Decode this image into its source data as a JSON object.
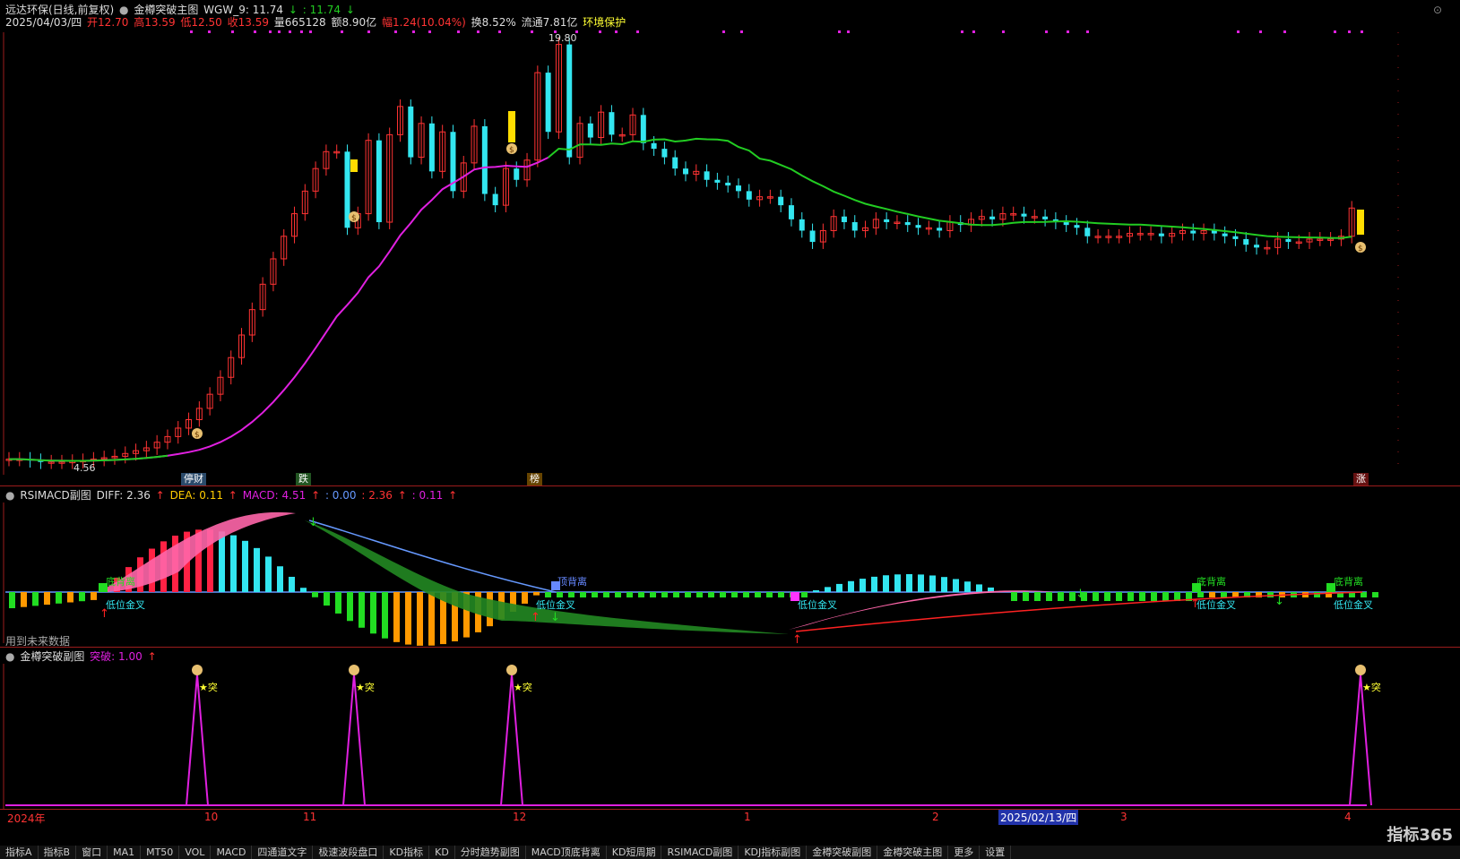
{
  "main": {
    "title": "远达环保(日线,前复权)",
    "indicator_name": "金樽突破主图",
    "wgw_label": "WGW_9: 11.74",
    "wgw_value2": ": 11.74",
    "date": "2025/04/03/四",
    "open": "开12.70",
    "high": "高13.59",
    "low": "低12.50",
    "close": "收13.59",
    "volume": "量665128",
    "amount": "额8.90亿",
    "change": "幅1.24(10.04%)",
    "turnover": "换8.52%",
    "float_cap": "流通7.81亿",
    "sector": "环境保护",
    "price_high_label": "19.80",
    "price_low_label": "4.56",
    "markers": [
      "停财",
      "跌",
      "榜",
      "涨"
    ]
  },
  "sub1": {
    "name": "RSIMACD副图",
    "diff": "DIFF: 2.36",
    "dea": "DEA: 0.11",
    "macd": "MACD: 4.51",
    "v1": ": 0.00",
    "v2": ": 2.36",
    "v3": ": 0.11",
    "note": "用到未来数据",
    "labels": [
      "底背离",
      "低位金叉",
      "顶背离",
      "低位金叉",
      "低位金叉",
      "底背离",
      "低位金叉",
      "底背离",
      "低位金叉"
    ]
  },
  "sub2": {
    "name": "金樽突破副图",
    "value": "突破: 1.00",
    "signal": "★突"
  },
  "axis": {
    "labels": [
      "2024年",
      "10",
      "11",
      "12",
      "1",
      "2",
      "2025/02/13/四",
      "3",
      "4"
    ]
  },
  "tabs": [
    "指标A",
    "指标B",
    "窗口",
    "MA1",
    "MT50",
    "VOL",
    "MACD",
    "四通道文字",
    "极速波段盘口",
    "KD指标",
    "KD",
    "分时趋势副图",
    "MACD顶底背离",
    "KD短周期",
    "RSIMACD副图",
    "KDJ指标副图",
    "金樽突破副图",
    "金樽突破主图",
    "更多",
    "设置"
  ],
  "logo": "指标365",
  "colors": {
    "up": "#ff3333",
    "down": "#33e6f0",
    "ma_up": "#e020e0",
    "ma_down": "#22cc22"
  }
}
